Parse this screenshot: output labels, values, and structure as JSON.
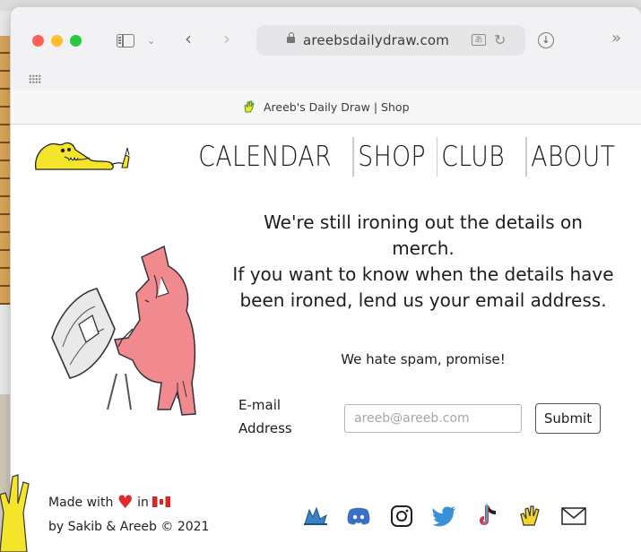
{
  "browser": {
    "url": "areebsdailydraw.com",
    "tab_title": "Areeb's Daily Draw | Shop"
  },
  "nav": {
    "items": [
      "CALENDAR",
      "SHOP",
      "CLUB",
      "ABOUT"
    ]
  },
  "main": {
    "message_line1": "We're still ironing out the details on merch.",
    "message_line2": "If you want to know when the details have been ironed, lend us your email address.",
    "promise": "We hate spam, promise!",
    "email_label_1": "E-mail",
    "email_label_2": "Address",
    "email_placeholder": "areeb@areeb.com",
    "submit_label": "Submit"
  },
  "footer": {
    "made_with": "Made with",
    "in": "in",
    "credit": "by Sakib & Areeb © 2021",
    "socials": [
      "webtoon-icon",
      "discord-icon",
      "instagram-icon",
      "twitter-icon",
      "tiktok-icon",
      "wave-hand-icon",
      "mail-icon"
    ]
  },
  "colors": {
    "accent_pink": "#f08a8f",
    "logo_yellow": "#f5e52a",
    "social_blue": "#3b82c4",
    "heart_red": "#e0282e"
  }
}
